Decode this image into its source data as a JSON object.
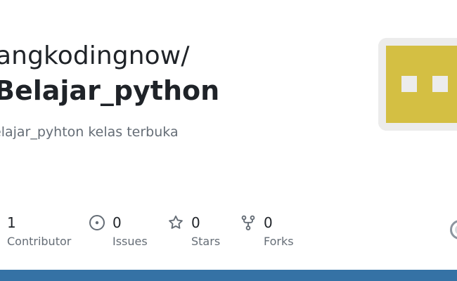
{
  "repo": {
    "owner": "angkodingnow/",
    "name": "Belajar_python",
    "description": "elajar_pyhton kelas terbuka"
  },
  "stats": {
    "contributors": {
      "value": "1",
      "label": "Contributor",
      "icon": "people-icon"
    },
    "issues": {
      "value": "0",
      "label": "Issues",
      "icon": "issue-opened-icon"
    },
    "stars": {
      "value": "0",
      "label": "Stars",
      "icon": "star-icon"
    },
    "forks": {
      "value": "0",
      "label": "Forks",
      "icon": "repo-forked-icon"
    }
  },
  "colors": {
    "text": "#1f2328",
    "muted": "#656d76",
    "icon": "#656d76",
    "avatar_background": "#ececec",
    "avatar_pattern": "#d4bf43",
    "bottom_bar": "#3572a5"
  }
}
